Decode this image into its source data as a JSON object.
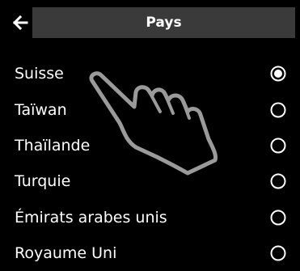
{
  "header": {
    "title": "Pays",
    "back_icon": "back-arrow-icon"
  },
  "countries": [
    {
      "label": "Suisse",
      "selected": true
    },
    {
      "label": "Taïwan",
      "selected": false
    },
    {
      "label": "Thaïlande",
      "selected": false
    },
    {
      "label": "Turquie",
      "selected": false
    },
    {
      "label": "Émirats arabes unis",
      "selected": false
    },
    {
      "label": "Royaume Uni",
      "selected": false
    }
  ],
  "colors": {
    "background": "#000000",
    "titlebar": "#3a3a3a",
    "text": "#ffffff",
    "hand_outline": "#9a9a9a"
  },
  "overlay": {
    "icon": "tap-hand-icon"
  }
}
